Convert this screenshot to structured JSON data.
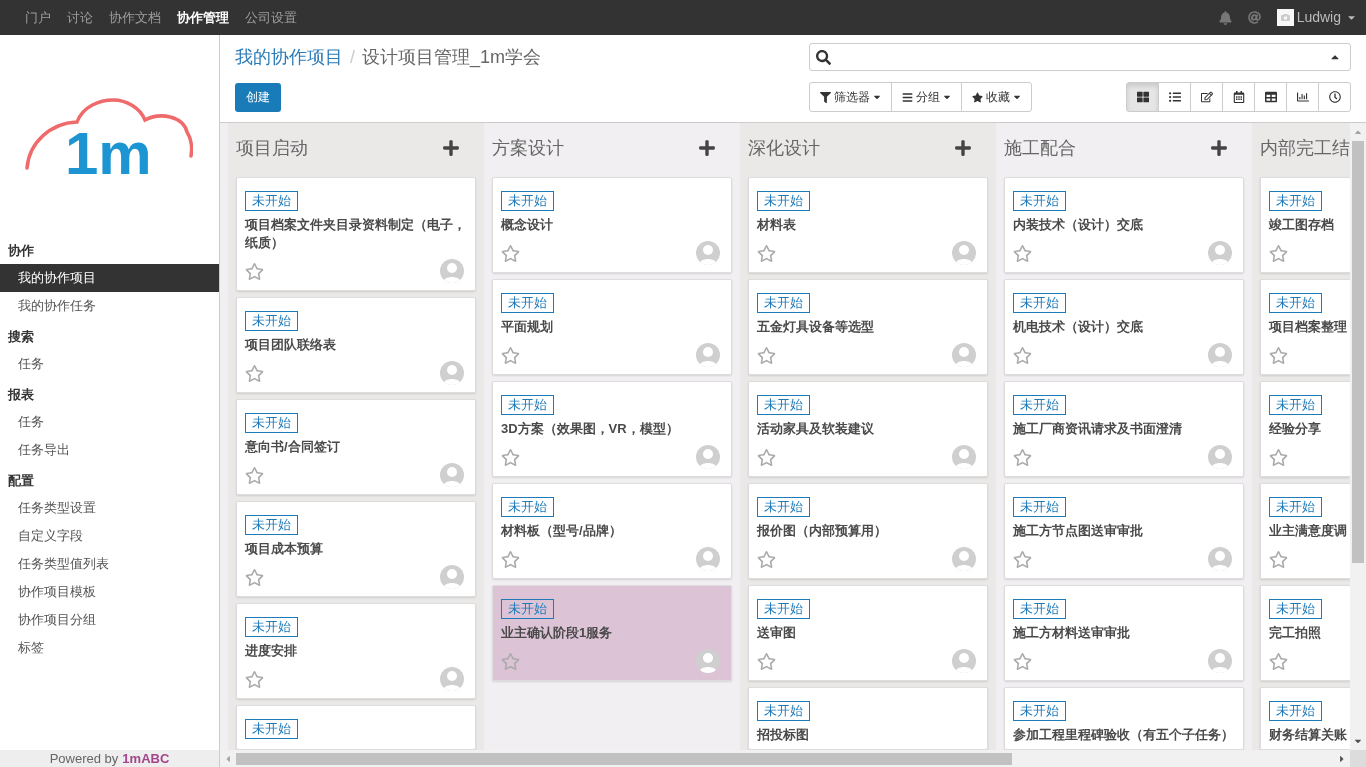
{
  "top_nav": {
    "items": [
      {
        "label": "门户",
        "selected": false
      },
      {
        "label": "讨论",
        "selected": false
      },
      {
        "label": "协作文档",
        "selected": false
      },
      {
        "label": "协作管理",
        "selected": true
      },
      {
        "label": "公司设置",
        "selected": false
      }
    ],
    "user": {
      "name": "Ludwig"
    }
  },
  "sidebar": {
    "logo": {
      "text": "1m"
    },
    "sections": [
      {
        "title": "协作",
        "items": [
          {
            "label": "我的协作项目",
            "selected": true
          },
          {
            "label": "我的协作任务",
            "selected": false
          }
        ]
      },
      {
        "title": "搜索",
        "items": [
          {
            "label": "任务",
            "selected": false
          }
        ]
      },
      {
        "title": "报表",
        "items": [
          {
            "label": "任务",
            "selected": false
          },
          {
            "label": "任务导出",
            "selected": false
          }
        ]
      },
      {
        "title": "配置",
        "items": [
          {
            "label": "任务类型设置",
            "selected": false
          },
          {
            "label": "自定义字段",
            "selected": false
          },
          {
            "label": "任务类型值列表",
            "selected": false
          },
          {
            "label": "协作项目模板",
            "selected": false
          },
          {
            "label": "协作项目分组",
            "selected": false
          },
          {
            "label": "标签",
            "selected": false
          }
        ]
      }
    ],
    "footer": {
      "text": "Powered by",
      "link": "1mABC"
    }
  },
  "breadcrumb": {
    "items": [
      {
        "label": "我的协作项目",
        "kind": "link"
      },
      {
        "label": "设计项目管理_1m学会",
        "kind": "current"
      }
    ],
    "separator": "/"
  },
  "create_button": "创建",
  "search_options": [
    {
      "kind": "filter",
      "label": "筛选器"
    },
    {
      "kind": "group",
      "label": "分组"
    },
    {
      "kind": "favorite",
      "label": "收藏"
    }
  ],
  "views": [
    {
      "kind": "kanban",
      "selected": true
    },
    {
      "kind": "list",
      "selected": false
    },
    {
      "kind": "form",
      "selected": false
    },
    {
      "kind": "calendar",
      "selected": false
    },
    {
      "kind": "pivot",
      "selected": false
    },
    {
      "kind": "graph",
      "selected": false
    },
    {
      "kind": "activity",
      "selected": false
    }
  ],
  "columns": [
    {
      "title": "项目启动",
      "add_button": true,
      "cards": [
        {
          "status": "未开始",
          "title": "项目档案文件夹目录资料制定（电子，纸质）",
          "starred": false,
          "avatar": true,
          "color": "#ffffff"
        },
        {
          "status": "未开始",
          "title": "项目团队联络表",
          "starred": false,
          "avatar": true,
          "color": "#ffffff"
        },
        {
          "status": "未开始",
          "title": "意向书/合同签订",
          "starred": false,
          "avatar": true,
          "color": "#ffffff"
        },
        {
          "status": "未开始",
          "title": "项目成本预算",
          "starred": false,
          "avatar": true,
          "color": "#ffffff"
        },
        {
          "status": "未开始",
          "title": "进度安排",
          "starred": false,
          "avatar": true,
          "color": "#ffffff"
        },
        {
          "status": "未开始",
          "cut": true,
          "color": "#ffffff"
        }
      ]
    },
    {
      "title": "方案设计",
      "add_button": true,
      "cards": [
        {
          "status": "未开始",
          "title": "概念设计",
          "starred": false,
          "avatar": true,
          "color": "#ffffff"
        },
        {
          "status": "未开始",
          "title": "平面规划",
          "starred": false,
          "avatar": true,
          "color": "#ffffff"
        },
        {
          "status": "未开始",
          "title": "3D方案（效果图，VR，模型）",
          "starred": false,
          "avatar": true,
          "color": "#ffffff"
        },
        {
          "status": "未开始",
          "title": "材料板（型号/品牌）",
          "starred": false,
          "avatar": true,
          "color": "#ffffff"
        },
        {
          "status": "未开始",
          "title": "业主确认阶段1服务",
          "starred": false,
          "avatar": true,
          "color": "#dcc4d6"
        }
      ]
    },
    {
      "title": "深化设计",
      "add_button": true,
      "cards": [
        {
          "status": "未开始",
          "title": "材料表",
          "starred": false,
          "avatar": true,
          "color": "#ffffff"
        },
        {
          "status": "未开始",
          "title": "五金灯具设备等选型",
          "starred": false,
          "avatar": true,
          "color": "#ffffff"
        },
        {
          "status": "未开始",
          "title": "活动家具及软装建议",
          "starred": false,
          "avatar": true,
          "color": "#ffffff"
        },
        {
          "status": "未开始",
          "title": "报价图（内部预算用）",
          "starred": false,
          "avatar": true,
          "color": "#ffffff"
        },
        {
          "status": "未开始",
          "title": "送审图",
          "starred": false,
          "avatar": true,
          "color": "#ffffff"
        },
        {
          "status": "未开始",
          "title": "招投标图",
          "cut": true,
          "color": "#ffffff"
        }
      ]
    },
    {
      "title": "施工配合",
      "add_button": true,
      "cards": [
        {
          "status": "未开始",
          "title": "内装技术（设计）交底",
          "starred": false,
          "avatar": true,
          "color": "#ffffff"
        },
        {
          "status": "未开始",
          "title": "机电技术（设计）交底",
          "starred": false,
          "avatar": true,
          "color": "#ffffff"
        },
        {
          "status": "未开始",
          "title": "施工厂商资讯请求及书面澄清",
          "starred": false,
          "avatar": true,
          "color": "#ffffff"
        },
        {
          "status": "未开始",
          "title": "施工方节点图送审审批",
          "starred": false,
          "avatar": true,
          "color": "#ffffff"
        },
        {
          "status": "未开始",
          "title": "施工方材料送审审批",
          "starred": false,
          "avatar": true,
          "color": "#ffffff"
        },
        {
          "status": "未开始",
          "title": "参加工程里程碑验收（有五个子任务）",
          "cut": true,
          "color": "#ffffff"
        }
      ]
    },
    {
      "title": "内部完工结",
      "add_button": false,
      "cards": [
        {
          "status": "未开始",
          "title": "竣工图存档",
          "starred": false,
          "avatar": false,
          "color": "#ffffff"
        },
        {
          "status": "未开始",
          "title": "项目档案整理",
          "starred": false,
          "avatar": false,
          "color": "#ffffff"
        },
        {
          "status": "未开始",
          "title": "经验分享",
          "starred": false,
          "avatar": false,
          "color": "#ffffff"
        },
        {
          "status": "未开始",
          "title": "业主满意度调",
          "starred": false,
          "avatar": false,
          "color": "#ffffff"
        },
        {
          "status": "未开始",
          "title": "完工拍照",
          "starred": false,
          "avatar": false,
          "color": "#ffffff"
        },
        {
          "status": "未开始",
          "title": "财务结算关账",
          "cut": true,
          "color": "#ffffff"
        }
      ]
    }
  ]
}
